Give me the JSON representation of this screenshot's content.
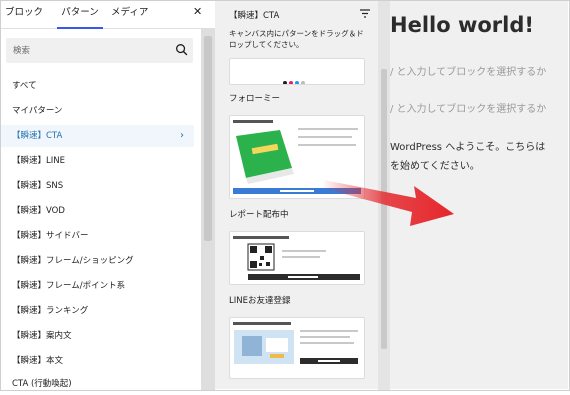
{
  "tabs": [
    {
      "label": "ブロック"
    },
    {
      "label": "パターン",
      "active": true
    },
    {
      "label": "メディア"
    }
  ],
  "search": {
    "placeholder": "検索"
  },
  "categories": [
    {
      "label": "すべて"
    },
    {
      "label": "マイパターン"
    },
    {
      "label": "【瞬速】CTA",
      "active": true
    },
    {
      "label": "【瞬速】LINE"
    },
    {
      "label": "【瞬速】SNS"
    },
    {
      "label": "【瞬速】VOD"
    },
    {
      "label": "【瞬速】サイドバー"
    },
    {
      "label": "【瞬速】フレーム/ショッピング"
    },
    {
      "label": "【瞬速】フレーム/ポイント系"
    },
    {
      "label": "【瞬速】ランキング"
    },
    {
      "label": "【瞬速】案内文"
    },
    {
      "label": "【瞬速】本文"
    },
    {
      "label": "CTA (行動喚起)"
    }
  ],
  "patterns_panel": {
    "title": "【瞬速】CTA",
    "description": "キャンバス内にパターンをドラッグ＆ドロップしてください。",
    "patterns": [
      {
        "label": ""
      },
      {
        "label": "フォローミー"
      },
      {
        "label": "レポート配布中"
      },
      {
        "label": "LINEお友達登録"
      }
    ],
    "dot_colors": [
      "#1e1e1e",
      "#e91e63",
      "#2196f3",
      "#9e9e9e"
    ]
  },
  "editor": {
    "title": "Hello world!",
    "placeholder1": "/ と入力してブロックを選択するか",
    "placeholder2": "/ と入力してブロックを選択するか",
    "paragraph_line1": "WordPress へようこそ。こちらは",
    "paragraph_line2": "を始めてください。"
  },
  "colors": {
    "accent": "#3858e9",
    "active_text": "#2271b1",
    "arrow": "#e5262b"
  }
}
